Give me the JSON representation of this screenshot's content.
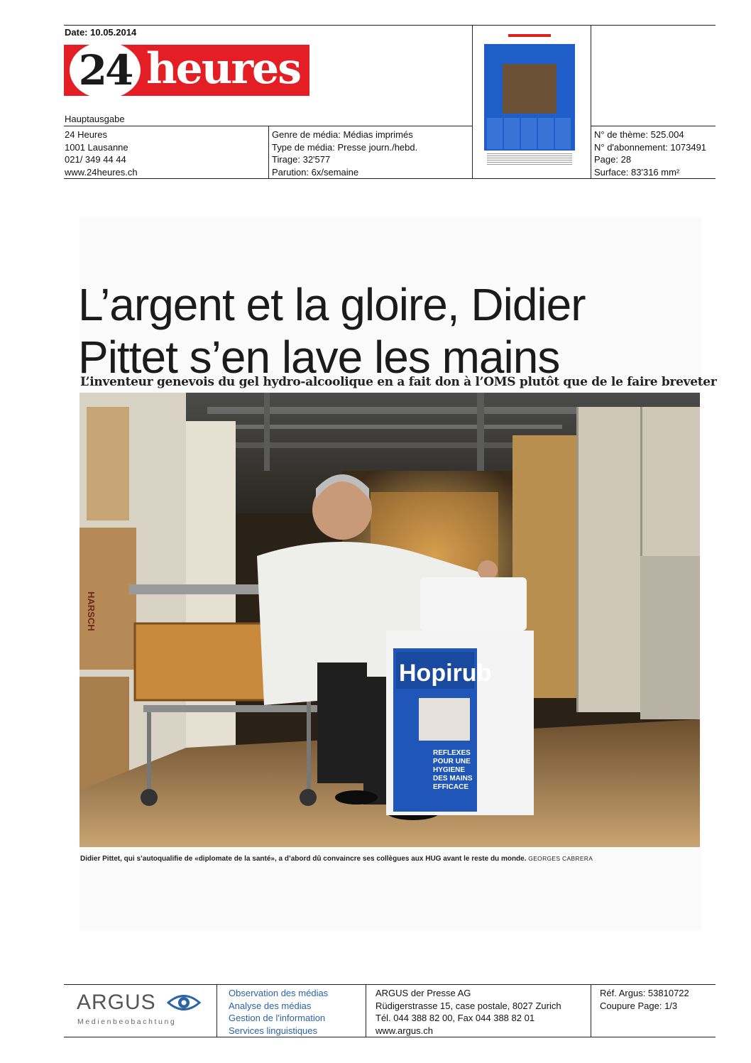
{
  "header": {
    "date": "Date: 10.05.2014",
    "logo": {
      "number": "24",
      "word": "heures"
    },
    "edition": "Hauptausgabe",
    "publisher": [
      "24 Heures",
      "1001 Lausanne",
      "021/ 349 44 44",
      "www.24heures.ch"
    ],
    "media_info": [
      "Genre de média: Médias imprimés",
      "Type de média: Presse journ./hebd.",
      "Tirage: 32'577",
      "Parution: 6x/semaine"
    ],
    "ref_info": [
      "N° de thème: 525.004",
      "N° d'abonnement: 1073491",
      "Page: 28",
      "Surface: 83'316 mm²"
    ]
  },
  "article": {
    "headline": [
      "L’argent et la gloire, Didier",
      "Pittet s’en lave les mains"
    ],
    "subhead": "L’inventeur genevois du gel hydro-alcoolique en a fait don à l’OMS plutôt que de le faire breveter",
    "caption": "Didier Pittet, qui s’autoqualifie de «diplomate de la santé», a d’abord dû convaincre ses collègues aux HUG avant le reste du monde.",
    "credit": "GEORGES CABRERA",
    "photo_texts": {
      "brand": "Hopirub",
      "reflexes": [
        "REFLEXES",
        "POUR UNE",
        "HYGIENE",
        "DES MAINS",
        "EFFICACE"
      ],
      "box_brand": "HARSCH"
    }
  },
  "footer": {
    "logo": {
      "word": "ARGUS",
      "sub": "Medienbeobachtung"
    },
    "services": [
      "Observation des médias",
      "Analyse des médias",
      "Gestion de l'information",
      "Services linguistiques"
    ],
    "address": [
      "ARGUS der Presse AG",
      "Rüdigerstrasse 15, case postale, 8027 Zurich",
      "Tél. 044 388 82 00, Fax 044 388 82 01",
      "www.argus.ch"
    ],
    "reference": [
      "Réf. Argus: 53810722",
      "Coupure Page: 1/3"
    ]
  },
  "colors": {
    "brand_red": "#e31e24",
    "argus_blue": "#2b63a8",
    "hopirub_blue": "#1f56b8"
  }
}
